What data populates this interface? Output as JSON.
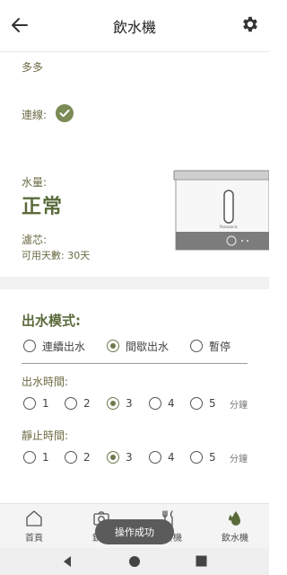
{
  "header": {
    "title": "飲水機"
  },
  "pet": {
    "name": "多多"
  },
  "connection": {
    "label": "連線:"
  },
  "water": {
    "label": "水量:",
    "value": "正常"
  },
  "filter": {
    "label": "濾芯:",
    "days": "可用天數: 30天"
  },
  "device": {
    "brand": "Panasonic"
  },
  "mode": {
    "title": "出水模式:",
    "options": [
      "連續出水",
      "間歇出水",
      "暫停"
    ],
    "selected": "間歇出水"
  },
  "flow_time": {
    "label": "出水時間:",
    "options": [
      "1",
      "2",
      "3",
      "4",
      "5"
    ],
    "selected": "3",
    "unit": "分鐘"
  },
  "rest_time": {
    "label": "靜止時間:",
    "options": [
      "1",
      "2",
      "3",
      "4",
      "5"
    ],
    "selected": "3",
    "unit": "分鐘"
  },
  "tabs": [
    {
      "label": "首頁",
      "icon": "home-icon"
    },
    {
      "label": "鏡頭",
      "icon": "camera-icon"
    },
    {
      "label": "餵食機",
      "icon": "feeder-icon"
    },
    {
      "label": "飲水機",
      "icon": "water-drop-icon",
      "active": true
    }
  ],
  "toast": {
    "text": "操作成功"
  },
  "colors": {
    "accent": "#5a6a3b",
    "radio_checked": "#6b7a4b",
    "check_circle": "#7a8b56"
  }
}
